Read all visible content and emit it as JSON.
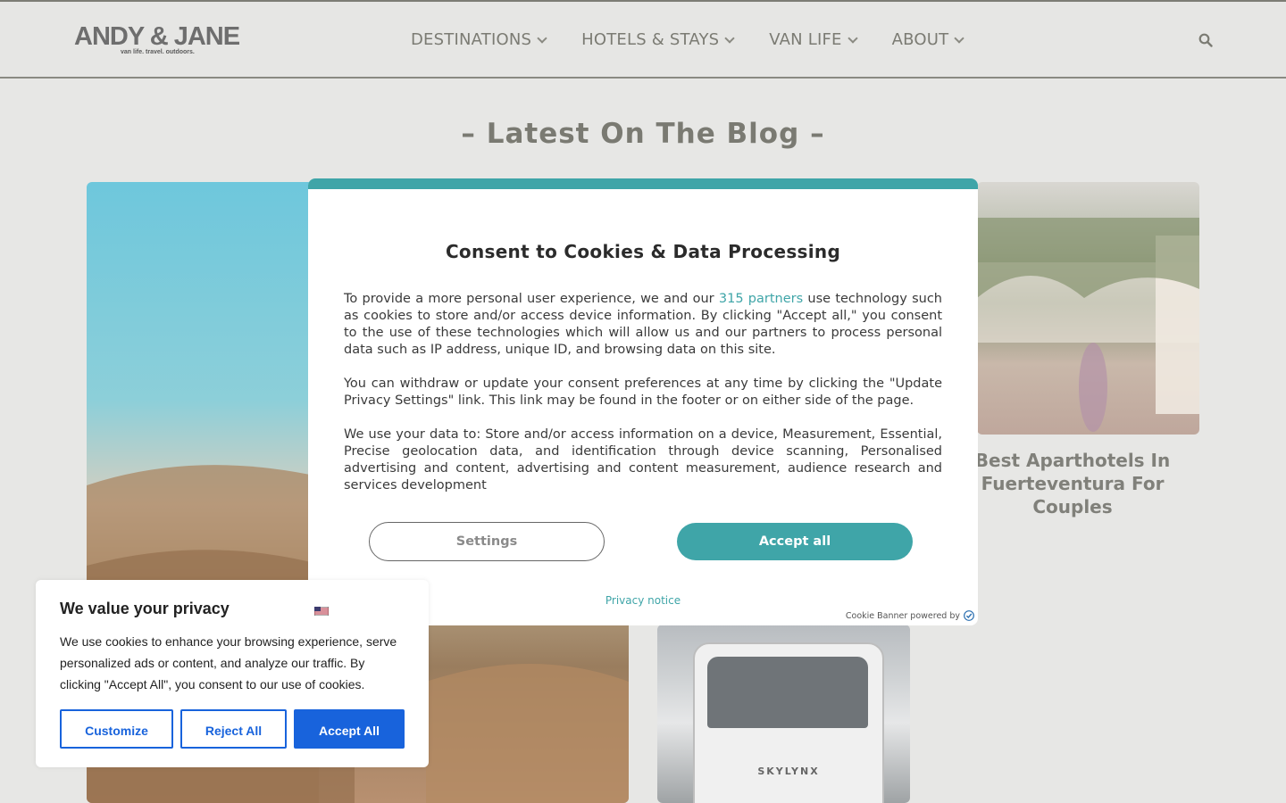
{
  "header": {
    "logo": {
      "main": "ANDY & JANE",
      "tagline": "van life. travel. outdoors."
    },
    "nav": [
      {
        "label": "DESTINATIONS"
      },
      {
        "label": "HOTELS & STAYS"
      },
      {
        "label": "VAN LIFE"
      },
      {
        "label": "ABOUT"
      }
    ],
    "search_icon": "search-icon"
  },
  "blog": {
    "title": "– Latest On The Blog –",
    "cards": [
      {
        "title": "Best Aparthotels In Fuerteventura For Couples"
      }
    ],
    "bus_brand": "SKYLYNX"
  },
  "consent_modal": {
    "accent_color": "#3fa5a8",
    "title": "Consent to Cookies & Data Processing",
    "para1_before": "To provide a more personal user experience, we and our ",
    "para1_link": "315 partners",
    "para1_after": " use technology such as cookies to store and/or access device information. By clicking \"Accept all,\" you consent to the use of these technologies which will allow us and our partners to process personal data such as IP address, unique ID, and browsing data on this site.",
    "para2": "You can withdraw or update your consent preferences at any time by clicking the \"Update Privacy Settings\" link. This link may be found in the footer or on either side of the page.",
    "para3": "We use your data to: Store and/or access information on a device, Measurement, Essential, Precise geolocation data, and identification through device scanning, Personalised advertising and content, advertising and content measurement, audience research and services development",
    "settings_label": "Settings",
    "accept_label": "Accept all",
    "privacy_notice": "Privacy notice",
    "powered_by": "Cookie Banner powered by"
  },
  "privacy_popup": {
    "accent_color": "#1863dc",
    "title": "We value your privacy",
    "text": "We use cookies to enhance your browsing experience, serve personalized ads or content, and analyze our traffic. By clicking \"Accept All\", you consent to our use of cookies.",
    "customize_label": "Customize",
    "reject_label": "Reject All",
    "accept_label": "Accept All",
    "flag_icon": "flag-icon"
  }
}
